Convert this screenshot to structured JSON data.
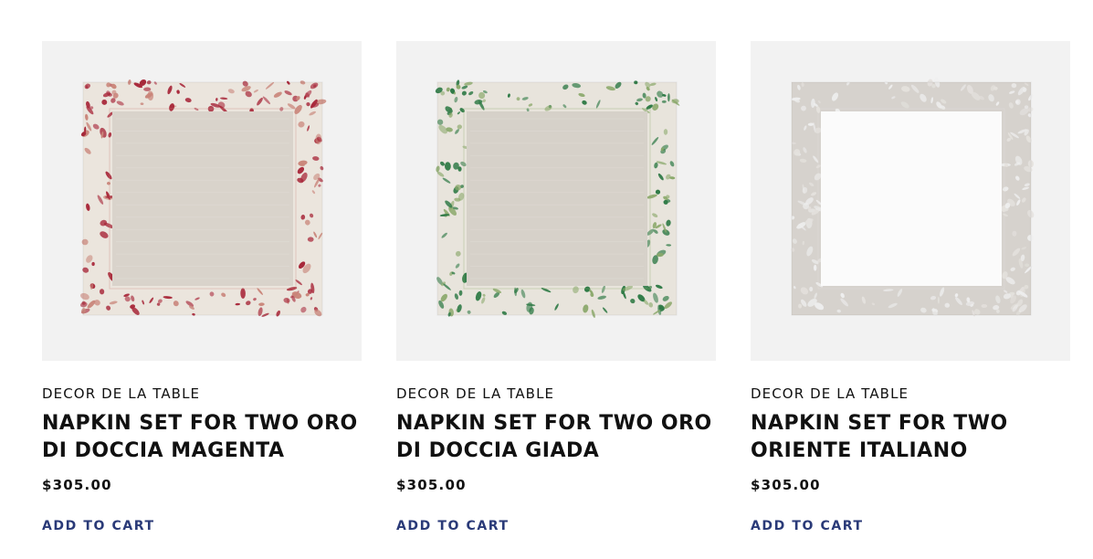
{
  "products": [
    {
      "brand": "DECOR DE LA TABLE",
      "title": "NAPKIN SET FOR TWO ORO DI DOCCIA MAGENTA",
      "price": "$305.00",
      "cta": "ADD TO CART",
      "image": "napkin-magenta-floral-border",
      "colors": {
        "center": "#d9d3cb",
        "border": "#ebe5dd",
        "motif": "#a8283a",
        "motif2": "#c9857a"
      }
    },
    {
      "brand": "DECOR DE LA TABLE",
      "title": "NAPKIN SET FOR TWO ORO DI DOCCIA GIADA",
      "price": "$305.00",
      "cta": "ADD TO CART",
      "image": "napkin-green-floral-border",
      "colors": {
        "center": "#d6d1c9",
        "border": "#e8e4dc",
        "motif": "#2f7a46",
        "motif2": "#8aa86a"
      }
    },
    {
      "brand": "DECOR DE LA TABLE",
      "title": "NAPKIN SET FOR TWO ORIENTE ITALIANO",
      "price": "$305.00",
      "cta": "ADD TO CART",
      "image": "napkin-white-grey-border",
      "colors": {
        "center": "#fbfbfb",
        "border": "#d6d2cd",
        "motif": "#eeeeee",
        "motif2": "#e4e1dd"
      }
    }
  ]
}
